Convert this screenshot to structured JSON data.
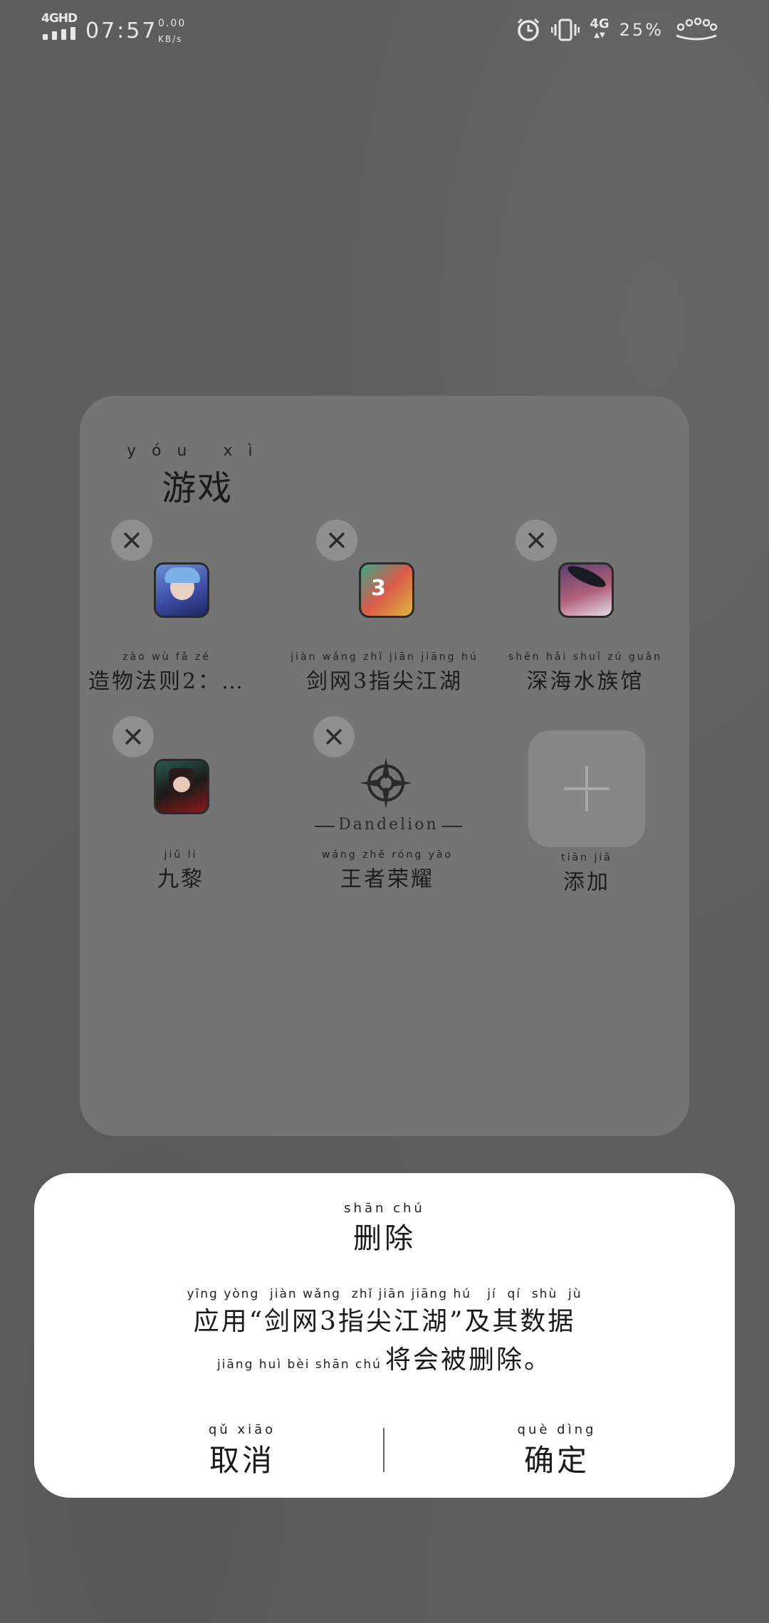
{
  "status_bar": {
    "network": "4GHD",
    "time": "07:57",
    "speed_value": "0.00",
    "speed_unit": "KB/s",
    "data_type": "4G",
    "battery": "25%"
  },
  "folder": {
    "title_pinyin": "yóu xì",
    "title": "游戏",
    "apps": [
      {
        "name": "造物法则2：…",
        "pinyin": "zào wù fǎ zé",
        "icon": "game-icon-anime-girl"
      },
      {
        "name": "剑网3指尖江湖",
        "pinyin": "jiàn wǎng zhǐ jiān jiāng hú",
        "icon": "game-icon-jx3"
      },
      {
        "name": "深海水族馆",
        "pinyin": "shēn hǎi shuǐ zú guǎn",
        "icon": "game-icon-aquarium"
      },
      {
        "name": "九黎",
        "pinyin": "jiǔ lí",
        "icon": "game-icon-jiuli"
      },
      {
        "name": "王者荣耀",
        "pinyin": "wáng zhě róng yào",
        "icon": "dandelion-icon",
        "icon_text": "Dandelion"
      }
    ],
    "add_tile": {
      "label": "添加",
      "pinyin": "tiān jiā"
    }
  },
  "dialog": {
    "title_pinyin": "shān chú",
    "title": "删除",
    "message_line1_pinyin": "yīng yòng  jiàn wǎng  zhǐ jiān jiāng hú   jí  qí  shù  jù",
    "message_line1": "应用“剑网3指尖江湖”及其数据",
    "message_line2_pinyin": "jiāng huì bèi shān chú",
    "message_line2": "将会被删除。",
    "cancel_pinyin": "qǔ xiāo",
    "cancel": "取消",
    "confirm_pinyin": "què dìng",
    "confirm": "确定"
  },
  "colors": {
    "background": "#5e5e5e",
    "folder": "#747474",
    "dialog": "#ffffff"
  }
}
